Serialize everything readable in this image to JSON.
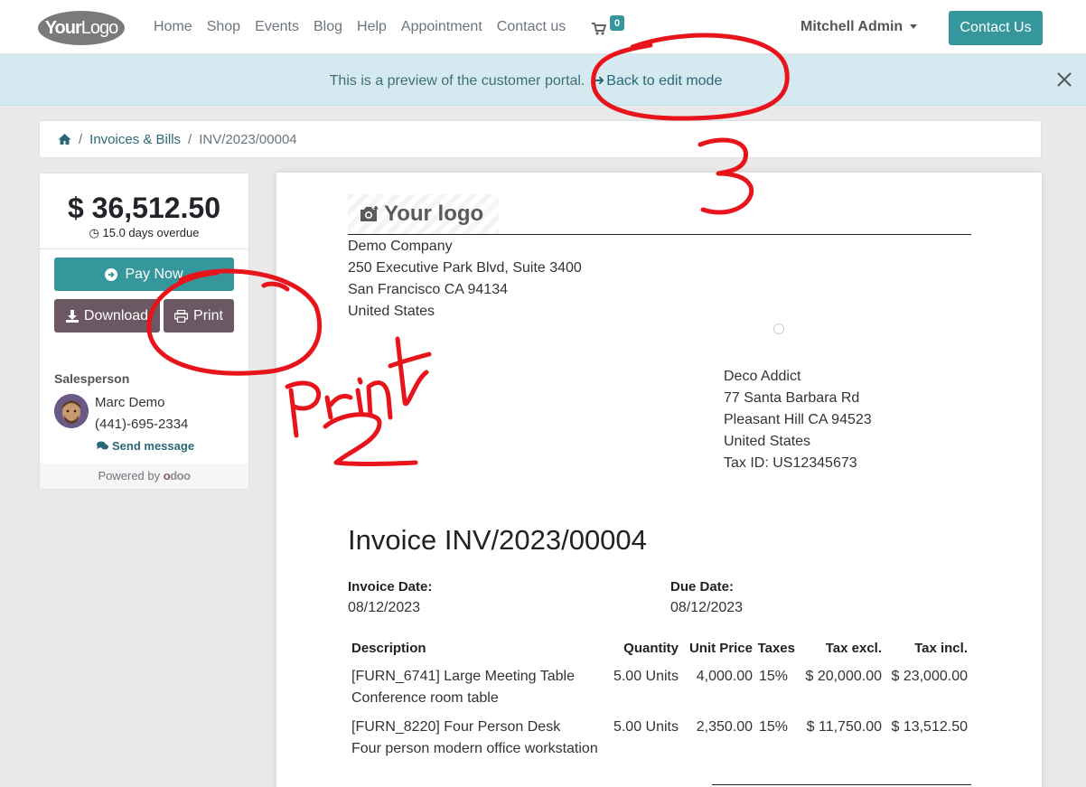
{
  "navbar": {
    "logo_bold": "Your",
    "logo_light": "Logo",
    "links": [
      "Home",
      "Shop",
      "Events",
      "Blog",
      "Help",
      "Appointment",
      "Contact us"
    ],
    "cart_count": "0",
    "user_name": "Mitchell Admin",
    "contact_button": "Contact Us"
  },
  "banner": {
    "text": "This is a preview of the customer portal.",
    "link": "Back to edit mode"
  },
  "breadcrumb": {
    "items": [
      "Invoices & Bills",
      "INV/2023/00004"
    ]
  },
  "sidebar": {
    "amount": "$ 36,512.50",
    "overdue": "15.0 days overdue",
    "pay_button": "Pay Now",
    "download_button": "Download",
    "print_button": "Print",
    "salesperson_label": "Salesperson",
    "salesperson_name": "Marc Demo",
    "salesperson_phone": "(441)-695-2334",
    "send_message": "Send message",
    "powered_by": "Powered by",
    "odoo_o": "o",
    "odoo_rest": "doo"
  },
  "document": {
    "logo_text": "Your logo",
    "company_lines": [
      "Demo Company",
      "250 Executive Park Blvd, Suite 3400",
      "San Francisco CA 94134",
      "United States"
    ],
    "customer_lines": [
      "Deco Addict",
      "77 Santa Barbara Rd",
      "Pleasant Hill CA 94523",
      "United States",
      "Tax ID: US12345673"
    ],
    "title": "Invoice INV/2023/00004",
    "invoice_date_label": "Invoice Date:",
    "invoice_date": "08/12/2023",
    "due_date_label": "Due Date:",
    "due_date": "08/12/2023",
    "columns": [
      "Description",
      "Quantity",
      "Unit Price",
      "Taxes",
      "Tax excl.",
      "Tax incl."
    ],
    "lines": [
      {
        "description": "[FURN_6741] Large Meeting Table",
        "note": "Conference room table",
        "quantity": "5.00 Units",
        "unit_price": "4,000.00",
        "taxes": "15%",
        "tax_excl": "$ 20,000.00",
        "tax_incl": "$ 23,000.00"
      },
      {
        "description": "[FURN_8220] Four Person Desk",
        "note": "Four person modern office workstation",
        "quantity": "5.00 Units",
        "unit_price": "2,350.00",
        "taxes": "15%",
        "tax_excl": "$ 11,750.00",
        "tax_incl": "$ 13,512.50"
      }
    ]
  },
  "annotations": {
    "color": "#e8141c",
    "handwriting": "print",
    "numbers": [
      "2",
      "3"
    ]
  },
  "colors": {
    "primary": "#35979c",
    "secondary": "#6c5863",
    "banner": "#d5eaf0"
  }
}
